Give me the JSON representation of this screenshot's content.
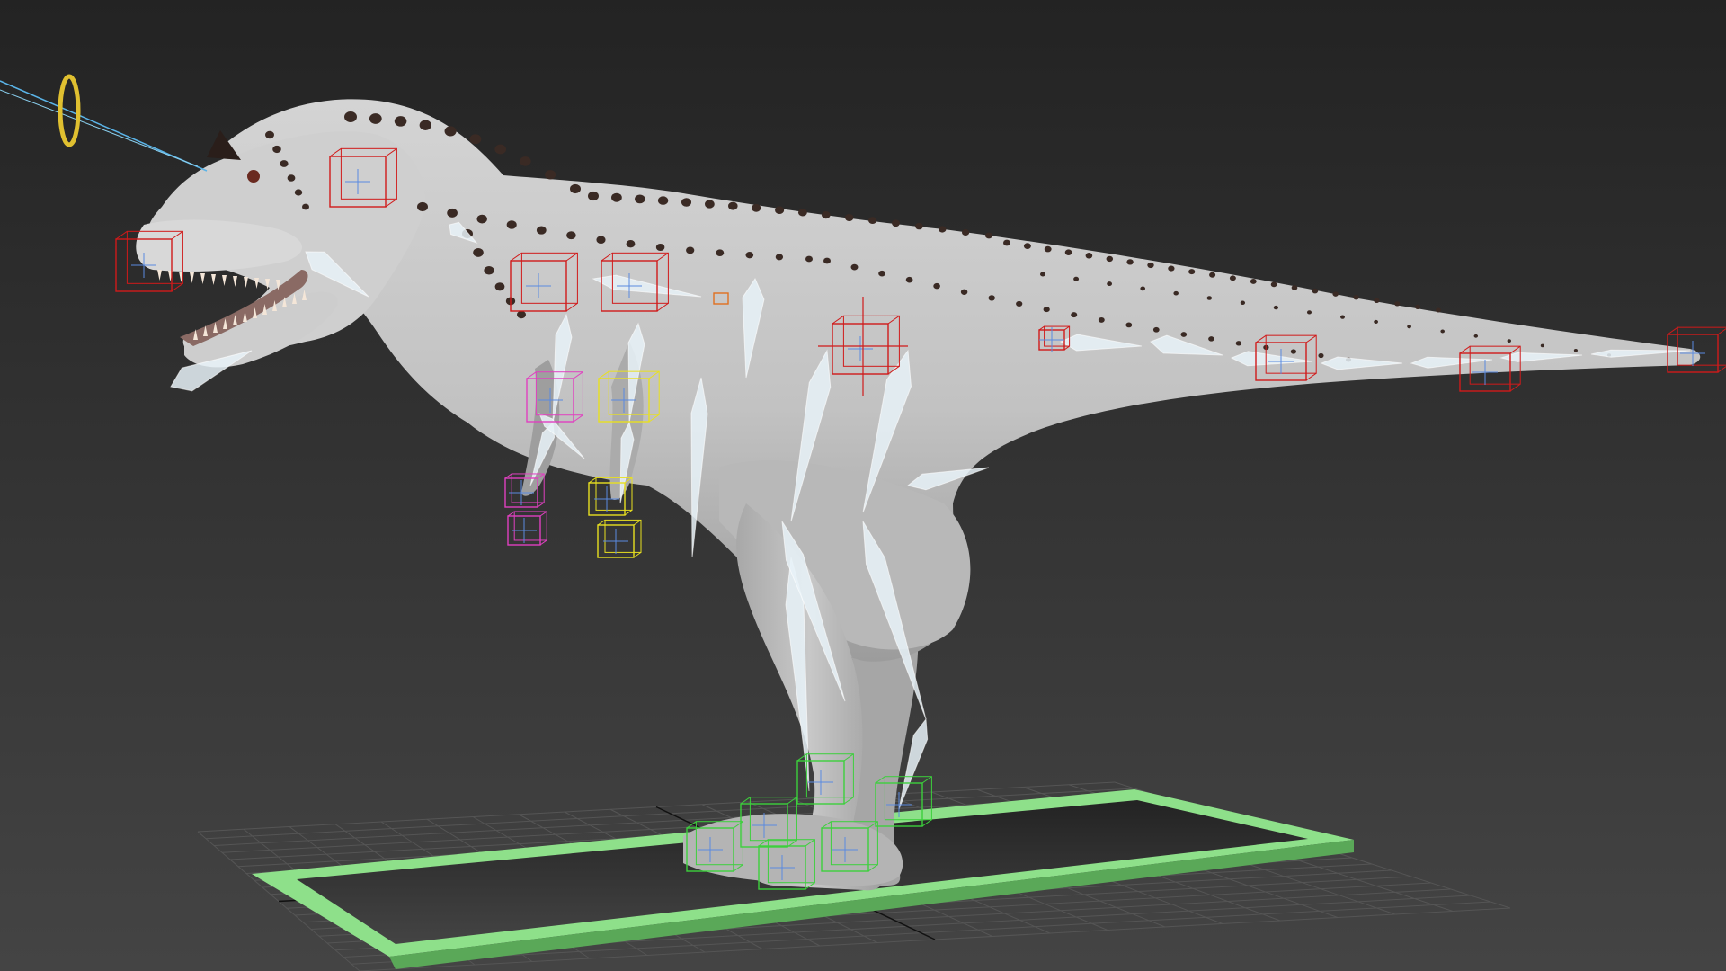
{
  "viewport": {
    "background_top": "#232323",
    "background_bottom": "#444444"
  },
  "grid": {
    "color": "#555555",
    "axis_color": "#111111"
  },
  "colors": {
    "body": "#c6c6c6",
    "body_shade": "#9a9a9a",
    "body_light": "#dcdcdc",
    "spots": "#3a2a24",
    "bone": "#e8f2f8",
    "fk_red": "#d01a1a",
    "ik_magenta": "#e040c0",
    "ik_yellow": "#e8e020",
    "foot_green": "#3cd03c",
    "root_ctrl": "#8ee08a",
    "root_ctrl_dark": "#5aa858",
    "lookat_ring": "#e0c030",
    "lookat_line": "#5ab4e8",
    "helper_orange": "#e07020"
  },
  "icons": {
    "lookat": "ring-icon",
    "controls": "box-icon"
  }
}
